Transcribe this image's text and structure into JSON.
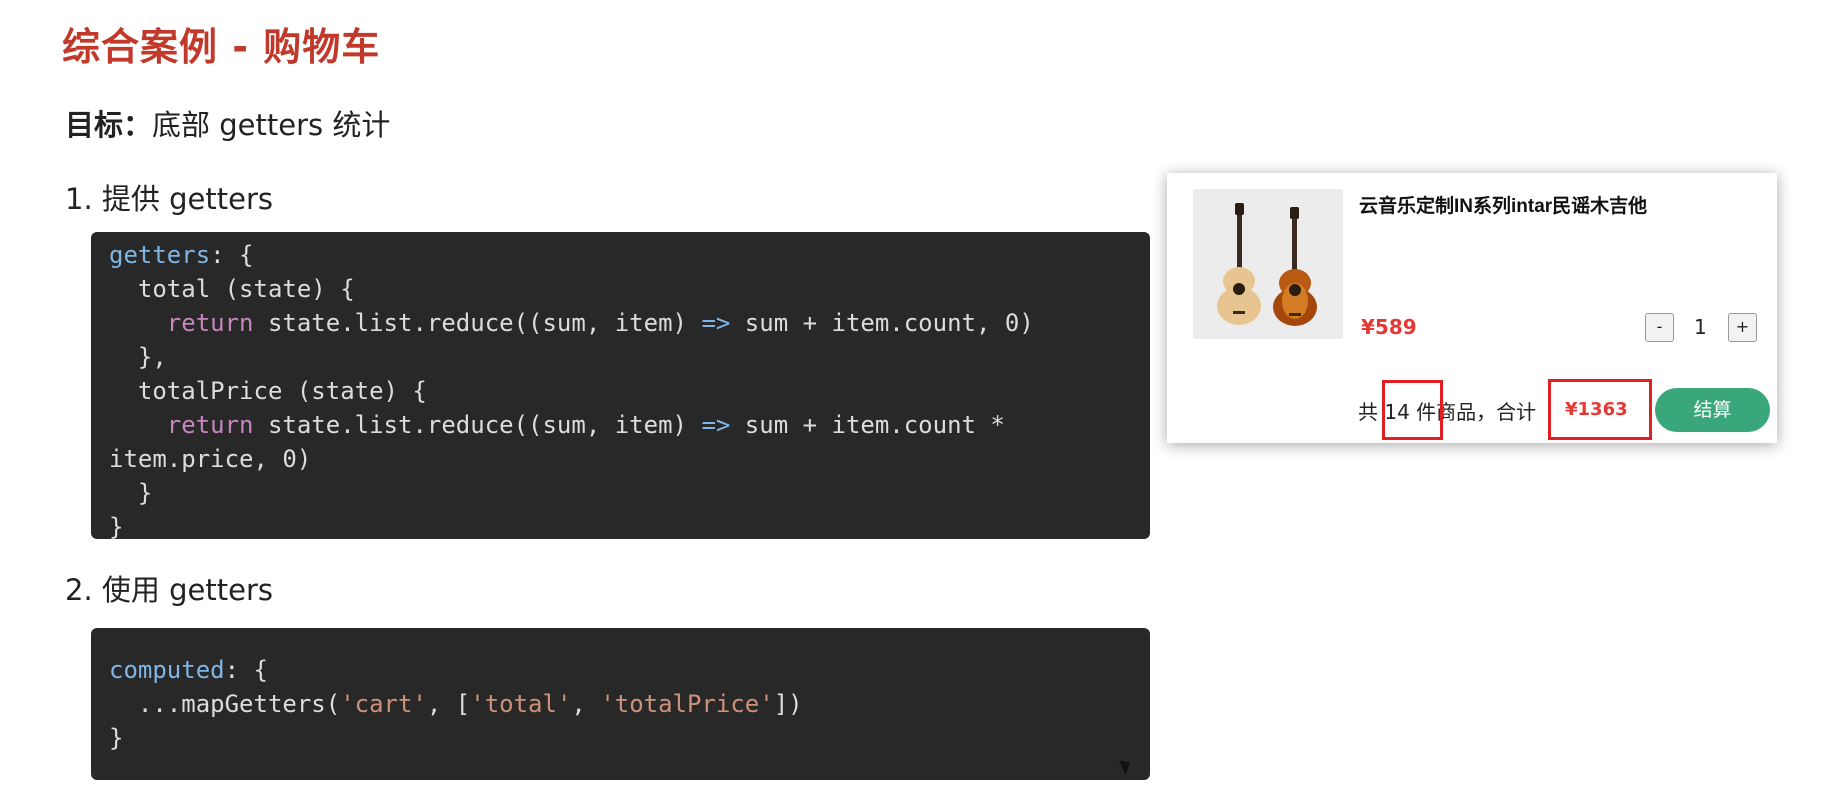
{
  "title": "综合案例 - 购物车",
  "goal": {
    "label": "目标：",
    "text": "底部 getters 统计"
  },
  "step1": "1.  提供 getters",
  "step2": "2.  使用 getters",
  "code1": {
    "l1a": "getters",
    "l1b": ": {",
    "l2": "  total (state) {",
    "l3a": "    ",
    "l3b": "return",
    "l3c": " state.list.reduce((sum, item) ",
    "l3d": "=>",
    "l3e": " sum + item.count, 0)",
    "l4": "  },",
    "l5": "  totalPrice (state) {",
    "l6a": "    ",
    "l6b": "return",
    "l6c": " state.list.reduce((sum, item) ",
    "l6d": "=>",
    "l6e": " sum + item.count *",
    "l7": "item.price, 0)",
    "l8": "  }",
    "l9": "}"
  },
  "code2": {
    "l1a": "computed",
    "l1b": ": {",
    "l2a": "  ...mapGetters(",
    "l2b": "'cart'",
    "l2c": ", [",
    "l2d": "'total'",
    "l2e": ", ",
    "l2f": "'totalPrice'",
    "l2g": "])",
    "l3": "}"
  },
  "cart": {
    "product_name": "云音乐定制IN系列intar民谣木吉他",
    "price": "¥589",
    "minus": "-",
    "qty": "1",
    "plus": "+",
    "footer_prefix": "共",
    "count": "14",
    "footer_suffix": "件商品，合计",
    "total_price": "¥1363",
    "checkout": "结算",
    "checkout_color": "#3aa77a",
    "highlight_color": "#e02020"
  }
}
